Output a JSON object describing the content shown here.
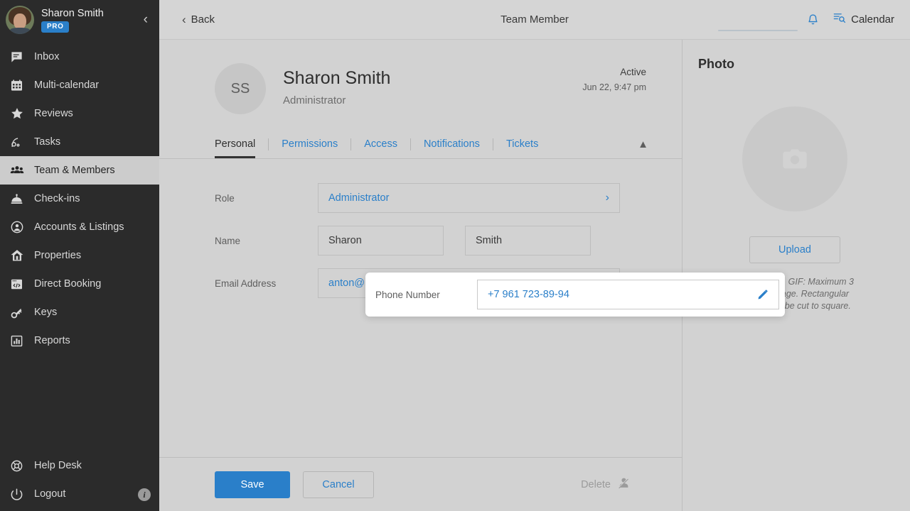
{
  "sidebar": {
    "user": {
      "name": "Sharon Smith",
      "badge": "PRO"
    },
    "collapse_icon": "chevron-left-icon",
    "items": [
      {
        "label": "Inbox",
        "icon": "chat-icon",
        "active": false
      },
      {
        "label": "Multi-calendar",
        "icon": "calendar-icon",
        "active": false
      },
      {
        "label": "Reviews",
        "icon": "star-icon",
        "active": false
      },
      {
        "label": "Tasks",
        "icon": "tasks-icon",
        "active": false
      },
      {
        "label": "Team & Members",
        "icon": "people-icon",
        "active": true
      },
      {
        "label": "Check-ins",
        "icon": "bell-desk-icon",
        "active": false
      },
      {
        "label": "Accounts & Listings",
        "icon": "account-circle-icon",
        "active": false
      },
      {
        "label": "Properties",
        "icon": "house-icon",
        "active": false
      },
      {
        "label": "Direct Booking",
        "icon": "code-window-icon",
        "active": false
      },
      {
        "label": "Keys",
        "icon": "key-icon",
        "active": false
      },
      {
        "label": "Reports",
        "icon": "bar-chart-icon",
        "active": false
      }
    ],
    "bottom_items": [
      {
        "label": "Help Desk",
        "icon": "lifebuoy-icon"
      },
      {
        "label": "Logout",
        "icon": "power-icon"
      }
    ],
    "info_badge": "i"
  },
  "topbar": {
    "back_label": "Back",
    "title": "Team Member",
    "bell_icon": "bell-icon",
    "calendar_icon": "calendar-search-icon",
    "calendar_label": "Calendar"
  },
  "profile": {
    "initials": "SS",
    "name": "Sharon Smith",
    "role": "Administrator",
    "status": "Active",
    "status_date": "Jun 22, 9:47 pm"
  },
  "tabs": [
    {
      "label": "Personal",
      "active": true
    },
    {
      "label": "Permissions",
      "active": false
    },
    {
      "label": "Access",
      "active": false
    },
    {
      "label": "Notifications",
      "active": false
    },
    {
      "label": "Tickets",
      "active": false
    }
  ],
  "tabs_collapse_icon": "chevron-up-icon",
  "form": {
    "role": {
      "label": "Role",
      "value": "Administrator",
      "chevron": "chevron-right-icon"
    },
    "name": {
      "label": "Name",
      "first": "Sharon",
      "last": "Smith"
    },
    "email": {
      "label": "Email Address",
      "value": "anton@igms.com",
      "edit_icon": "pencil-icon"
    },
    "phone": {
      "label": "Phone Number",
      "value": "+7 961 723-89-94",
      "edit_icon": "pencil-icon"
    }
  },
  "footer": {
    "save_label": "Save",
    "cancel_label": "Cancel",
    "delete_label": "Delete",
    "delete_icon": "user-slash-icon"
  },
  "photo": {
    "title": "Photo",
    "placeholder_icon": "camera-icon",
    "upload_label": "Upload",
    "hint": "PNG, JPEG, GIF: Maximum 3 MB per image. Rectangular images will be cut to square."
  },
  "colors": {
    "accent": "#2a7fc9",
    "sidebar_bg": "#2b2b2b",
    "sidebar_active_bg": "#cccccc",
    "page_bg": "#d2d2d2",
    "muted_text": "#9b9b9b"
  }
}
